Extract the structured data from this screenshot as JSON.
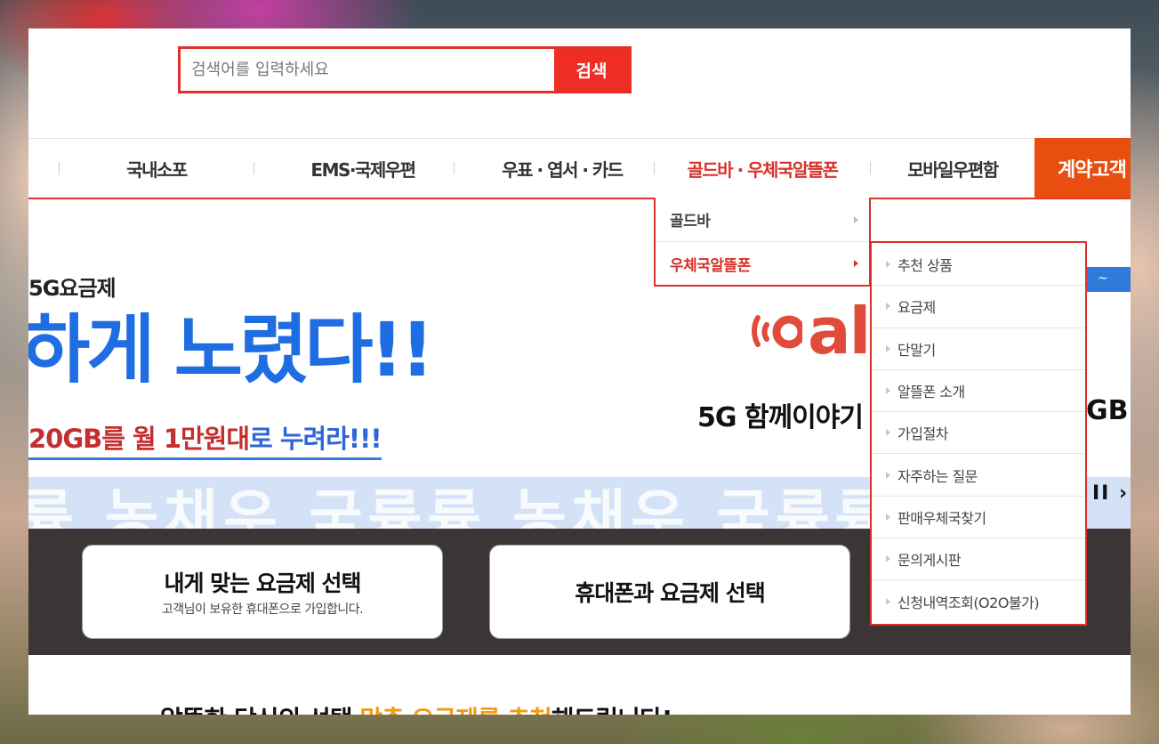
{
  "search": {
    "placeholder": "검색어를 입력하세요",
    "button_label": "검색"
  },
  "nav": {
    "items": [
      {
        "label": "국내소포"
      },
      {
        "label": "EMS·국제우편"
      },
      {
        "label": "우표 · 엽서 · 카드"
      },
      {
        "label": "골드바 · 우체국알뜰폰",
        "active": true
      },
      {
        "label": "모바일우편함"
      }
    ],
    "cta_label": "계약고객"
  },
  "dropdown": {
    "level1": [
      {
        "label": "골드바"
      },
      {
        "label": "우체국알뜰폰",
        "active": true
      }
    ],
    "level2": [
      {
        "label": "추천 상품"
      },
      {
        "label": "요금제"
      },
      {
        "label": "단말기"
      },
      {
        "label": "알뜰폰 소개"
      },
      {
        "label": "가입절차"
      },
      {
        "label": "자주하는 질문"
      },
      {
        "label": "판매우체국찾기"
      },
      {
        "label": "문의게시판"
      },
      {
        "label": "신청내역조회(O2O불가)"
      }
    ]
  },
  "banner": {
    "tag": "5G요금제",
    "headline": "하게 노렸다!!",
    "sub_red": "20GB를 월 1만원대",
    "sub_blue": "로 누려라!!!",
    "logo_text": "alc",
    "product_line": "5G 함께이야기",
    "product_line_end": "GB)",
    "chip": "~",
    "wave_text": "륭 농채우 국륭륭 농채우 국륭륭",
    "controls": "II ›"
  },
  "cards": [
    {
      "title": "내게 맞는 요금제 선택",
      "desc": "고객님이 보유한 휴대폰으로 가입합니다."
    },
    {
      "title": "휴대폰과 요금제 선택",
      "desc": ""
    }
  ],
  "bottom": {
    "prefix": "알뜰한 당신의 선택 ",
    "highlight": "맞춤 요금제를 추천",
    "suffix": "해드립니다!"
  },
  "colors": {
    "accent_red": "#d8322b",
    "search_btn": "#ee2e24",
    "cta_orange": "#e84e0f",
    "banner_blue": "#1f6de3"
  }
}
